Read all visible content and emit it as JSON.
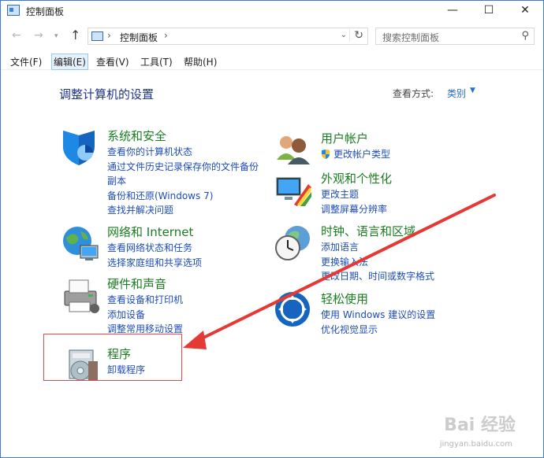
{
  "window": {
    "title": "控制面板"
  },
  "window_controls": {
    "minimize": "—",
    "maximize": "☐",
    "close": "✕"
  },
  "address": {
    "breadcrumb": "控制面板",
    "search_placeholder": "搜索控制面板"
  },
  "menu": [
    "文件(F)",
    "编辑(E)",
    "查看(V)",
    "工具(T)",
    "帮助(H)"
  ],
  "content": {
    "title": "调整计算机的设置",
    "view_label": "查看方式:",
    "view_value": "类别"
  },
  "categories": [
    {
      "title": "系统和安全",
      "icon": "shield-icon",
      "links": [
        "查看你的计算机状态",
        "通过文件历史记录保存你的文件备份副本",
        "备份和还原(Windows 7)",
        "查找并解决问题"
      ]
    },
    {
      "title": "网络和 Internet",
      "icon": "network-globe-icon",
      "links": [
        "查看网络状态和任务",
        "选择家庭组和共享选项"
      ]
    },
    {
      "title": "硬件和声音",
      "icon": "printer-icon",
      "links": [
        "查看设备和打印机",
        "添加设备",
        "调整常用移动设置"
      ]
    },
    {
      "title": "程序",
      "icon": "programs-icon",
      "links": [
        "卸载程序"
      ]
    },
    {
      "title": "用户帐户",
      "icon": "users-icon",
      "links": [
        "更改帐户类型"
      ]
    },
    {
      "title": "外观和个性化",
      "icon": "appearance-icon",
      "links": [
        "更改主题",
        "调整屏幕分辨率"
      ]
    },
    {
      "title": "时钟、语言和区域",
      "icon": "clock-globe-icon",
      "links": [
        "添加语言",
        "更换输入法",
        "更改日期、时间或数字格式"
      ]
    },
    {
      "title": "轻松使用",
      "icon": "ease-of-access-icon",
      "links": [
        "使用 Windows 建议的设置",
        "优化视觉显示"
      ]
    }
  ],
  "colors": {
    "category_title": "#1a7d21",
    "link": "#1e4db7",
    "page_title": "#1e3287",
    "annotation": "#e44a4a"
  },
  "watermark": {
    "brand": "Bai 经验",
    "url": "jingyan.baidu.com"
  }
}
